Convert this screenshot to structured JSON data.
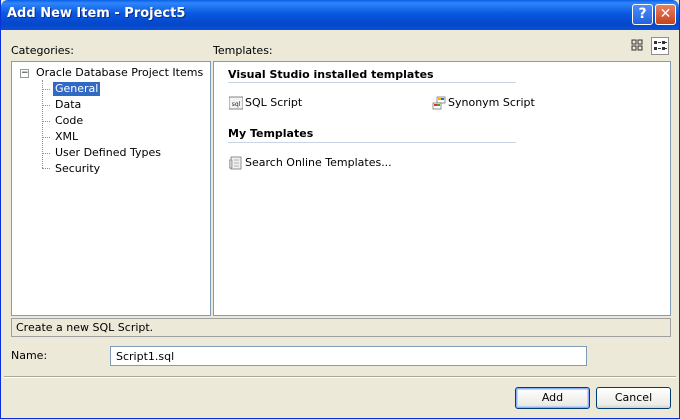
{
  "window": {
    "title": "Add New Item - Project5"
  },
  "titlebar_buttons": {
    "help": "?",
    "close": "✕"
  },
  "categories": {
    "label": "Categories:",
    "root": {
      "label": "Oracle Database Project Items",
      "expander": "−"
    },
    "items": [
      {
        "label": "General",
        "selected": true
      },
      {
        "label": "Data"
      },
      {
        "label": "Code"
      },
      {
        "label": "XML"
      },
      {
        "label": "User Defined Types"
      },
      {
        "label": "Security"
      }
    ]
  },
  "templates": {
    "label": "Templates:",
    "groups": [
      {
        "heading": "Visual Studio installed templates",
        "items": [
          {
            "label": "SQL Script",
            "icon": "sql-icon"
          },
          {
            "label": "Synonym Script",
            "icon": "synonym-icon"
          }
        ]
      },
      {
        "heading": "My Templates",
        "items": [
          {
            "label": "Search Online Templates...",
            "icon": "search-online-icon"
          }
        ]
      }
    ]
  },
  "view_buttons": {
    "large_icons": "large-icons-icon",
    "small_icons": "small-icons-icon",
    "active": "small_icons"
  },
  "description": "Create a new SQL Script.",
  "name_field": {
    "label": "Name:",
    "value": "Script1.sql"
  },
  "buttons": {
    "add": "Add",
    "cancel": "Cancel"
  },
  "colors": {
    "title_bar": "#0a58e0",
    "selection": "#316ac5",
    "dialog_bg": "#ece9d8",
    "panel_border": "#7f9db9"
  }
}
